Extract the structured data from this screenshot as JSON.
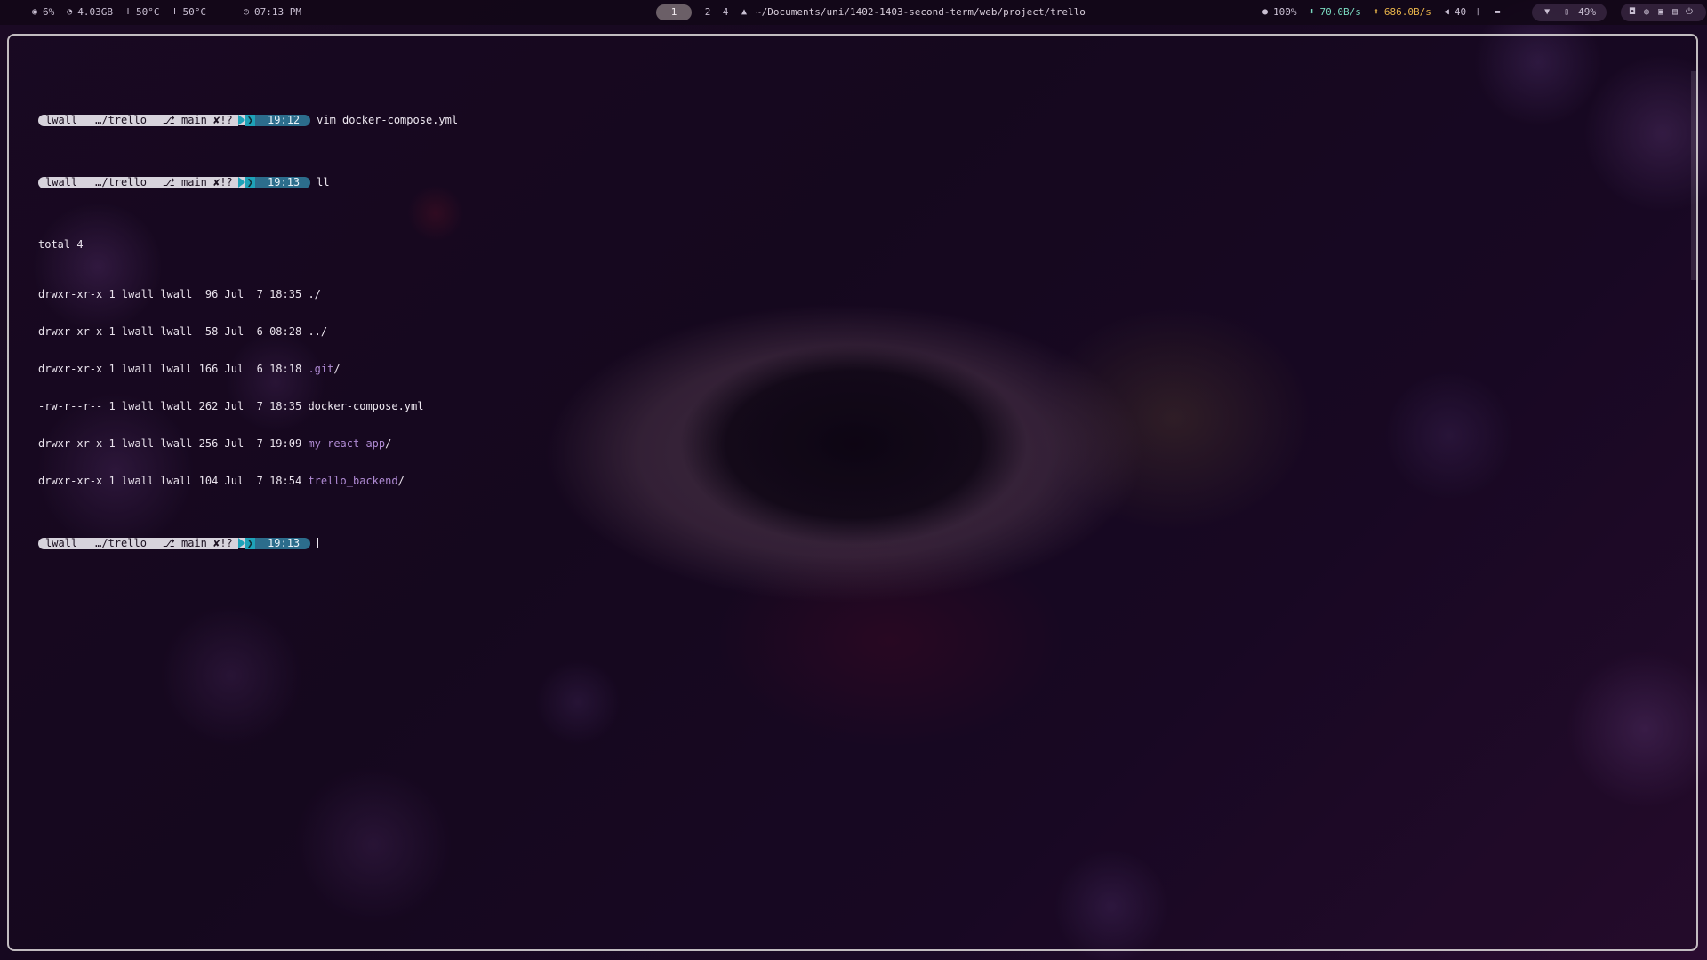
{
  "topbar": {
    "cpu": "6%",
    "ram": "4.03GB",
    "temp1": "50°C",
    "temp2": "50°C",
    "clock": "07:13 PM",
    "workspaces": [
      "1",
      "2",
      "4"
    ],
    "active_workspace": "1",
    "path": "~/Documents/uni/1402-1403-second-term/web/project/trello",
    "brightness": "100%",
    "download": "70.0B/s",
    "upload": "686.0B/s",
    "volume": "40",
    "battery": "49%",
    "icons": {
      "cpu": "cpu-icon",
      "ram": "memory-icon",
      "temp": "thermometer-icon",
      "clock": "clock-icon",
      "path": "arch-logo-icon",
      "brightness": "brightness-icon",
      "download": "download-arrow-icon",
      "upload": "upload-arrow-icon",
      "volume": "speaker-icon",
      "mic": "microphone-icon",
      "keyboard": "keyboard-icon",
      "wifi": "wifi-icon",
      "battery": "battery-icon",
      "sys": [
        "ghost-icon",
        "palette-icon",
        "screenshot-icon",
        "clipboard-icon",
        "power-icon"
      ]
    }
  },
  "terminal": {
    "prompts": [
      {
        "user": "lwall",
        "dir": "…/trello",
        "git": "main ✘!?",
        "time": "19:12",
        "command": "vim docker-compose.yml"
      },
      {
        "user": "lwall",
        "dir": "…/trello",
        "git": "main ✘!?",
        "time": "19:13",
        "command": "ll"
      },
      {
        "user": "lwall",
        "dir": "…/trello",
        "git": "main ✘!?",
        "time": "19:13",
        "command": ""
      }
    ],
    "output_total": "total 4",
    "listing": [
      {
        "meta": "drwxr-xr-x 1 lwall lwall  96 Jul  7 18:35 ",
        "name": "./",
        "kind": "plain"
      },
      {
        "meta": "drwxr-xr-x 1 lwall lwall  58 Jul  6 08:28 ",
        "name": "../",
        "kind": "plain"
      },
      {
        "meta": "drwxr-xr-x 1 lwall lwall 166 Jul  6 18:18 ",
        "name": ".git",
        "suffix": "/",
        "kind": "dir"
      },
      {
        "meta": "-rw-r--r-- 1 lwall lwall 262 Jul  7 18:35 ",
        "name": "docker-compose.yml",
        "kind": "plain"
      },
      {
        "meta": "drwxr-xr-x 1 lwall lwall 256 Jul  7 19:09 ",
        "name": "my-react-app",
        "suffix": "/",
        "kind": "dir"
      },
      {
        "meta": "drwxr-xr-x 1 lwall lwall 104 Jul  7 18:54 ",
        "name": "trello_backend",
        "suffix": "/",
        "kind": "dir"
      }
    ],
    "colors": {
      "prompt_bg": "#d7d3dc",
      "chevron": "#1ea2b8",
      "time_bg": "#2c6d8c",
      "dir_name": "#b08bd4",
      "border": "#e1dcdc"
    }
  }
}
